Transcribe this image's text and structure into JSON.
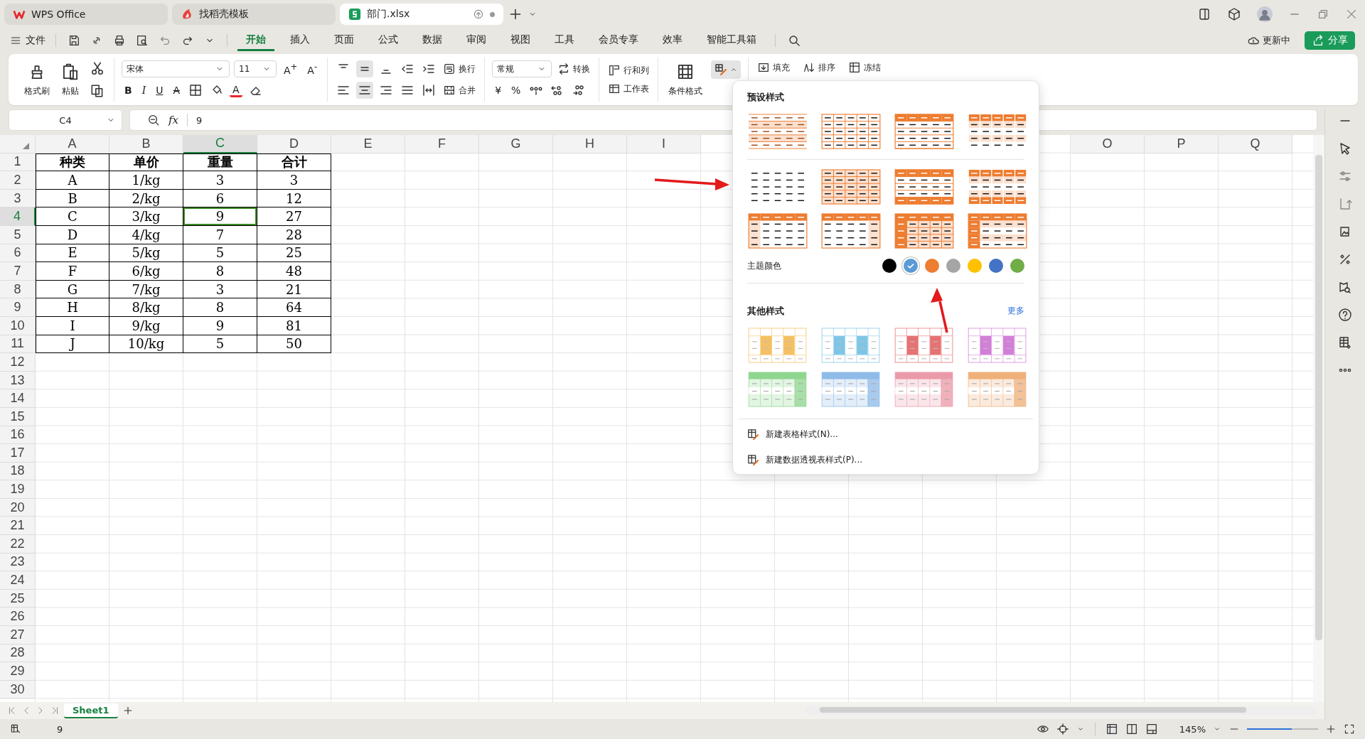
{
  "title_tabs": [
    {
      "label": "WPS Office",
      "kind": "wps",
      "selected": false
    },
    {
      "label": "找稻壳模板",
      "kind": "docer",
      "selected": false
    },
    {
      "label": "部门.xlsx",
      "kind": "sheet",
      "selected": true
    }
  ],
  "menu": {
    "file": "文件",
    "tabs": [
      {
        "label": "开始",
        "selected": true
      },
      {
        "label": "插入",
        "selected": false
      },
      {
        "label": "页面",
        "selected": false
      },
      {
        "label": "公式",
        "selected": false
      },
      {
        "label": "数据",
        "selected": false
      },
      {
        "label": "审阅",
        "selected": false
      },
      {
        "label": "视图",
        "selected": false
      },
      {
        "label": "工具",
        "selected": false
      },
      {
        "label": "会员专享",
        "selected": false
      },
      {
        "label": "效率",
        "selected": false
      },
      {
        "label": "智能工具箱",
        "selected": false
      }
    ],
    "sync": "更新中",
    "share": "分享"
  },
  "ribbon": {
    "format_painter": "格式刷",
    "paste": "粘贴",
    "font_name": "宋体",
    "font_size": "11",
    "grow": "A$^{+}$",
    "shrink": "A$^{-}$",
    "styles": [
      {
        "label": "B",
        "kind": "bold"
      },
      {
        "label": "I",
        "kind": "italic"
      },
      {
        "label": "U",
        "kind": "underline"
      },
      {
        "label": "A",
        "kind": "strike"
      }
    ],
    "font_color": "A",
    "align_top": [
      {
        "kind": "top",
        "selected": false
      },
      {
        "kind": "middle",
        "selected": true
      },
      {
        "kind": "bottom",
        "selected": false
      },
      {
        "kind": "outdent",
        "selected": false
      },
      {
        "kind": "indent",
        "selected": false
      }
    ],
    "wrap": "换行",
    "align_bottom": [
      {
        "kind": "left",
        "selected": false
      },
      {
        "kind": "center",
        "selected": true
      },
      {
        "kind": "right",
        "selected": false
      },
      {
        "kind": "justify",
        "selected": false
      },
      {
        "kind": "distribute",
        "selected": false
      }
    ],
    "merge": "合并",
    "number_format": "常规",
    "convert": "转换",
    "currency": "¥",
    "percent": "%",
    "rows_cols": "行和列",
    "worksheet": "工作表",
    "conditional": "条件格式",
    "table_style": {
      "expanded": true
    },
    "fill": "填充",
    "sort": "排序",
    "freeze": "冻结"
  },
  "formula_bar": {
    "name_box": "C4",
    "fx": "fx",
    "value": "9"
  },
  "sheet": {
    "columns": [
      {
        "label": "A",
        "selected": false
      },
      {
        "label": "B",
        "selected": false
      },
      {
        "label": "C",
        "selected": true
      },
      {
        "label": "D",
        "selected": false
      },
      {
        "label": "E",
        "selected": false
      },
      {
        "label": "F",
        "selected": false
      },
      {
        "label": "G",
        "selected": false
      },
      {
        "label": "H",
        "selected": false
      },
      {
        "label": "I",
        "selected": false
      },
      {},
      {},
      {},
      {},
      {},
      {
        "label": "O",
        "selected": false
      },
      {
        "label": "P",
        "selected": false
      },
      {
        "label": "Q",
        "selected": false
      }
    ],
    "rows": [
      {
        "label": "1",
        "selected": false,
        "kind": "header",
        "cells": [
          {
            "text": "种类",
            "selected": false
          },
          {
            "text": "单价",
            "selected": false
          },
          {
            "text": "重量",
            "selected": false
          },
          {
            "text": "合计",
            "selected": false
          }
        ]
      },
      {
        "label": "2",
        "selected": false,
        "kind": "data",
        "cells": [
          {
            "text": "A",
            "selected": false
          },
          {
            "text": "1/kg",
            "selected": false
          },
          {
            "text": "3",
            "selected": false
          },
          {
            "text": "3",
            "selected": false
          }
        ]
      },
      {
        "label": "3",
        "selected": false,
        "kind": "data",
        "cells": [
          {
            "text": "B",
            "selected": false
          },
          {
            "text": "2/kg",
            "selected": false
          },
          {
            "text": "6",
            "selected": false
          },
          {
            "text": "12",
            "selected": false
          }
        ]
      },
      {
        "label": "4",
        "selected": true,
        "kind": "data",
        "cells": [
          {
            "text": "C",
            "selected": false
          },
          {
            "text": "3/kg",
            "selected": false
          },
          {
            "text": "9",
            "selected": true
          },
          {
            "text": "27",
            "selected": false
          }
        ]
      },
      {
        "label": "5",
        "selected": false,
        "kind": "data",
        "cells": [
          {
            "text": "D",
            "selected": false
          },
          {
            "text": "4/kg",
            "selected": false
          },
          {
            "text": "7",
            "selected": false
          },
          {
            "text": "28",
            "selected": false
          }
        ]
      },
      {
        "label": "6",
        "selected": false,
        "kind": "data",
        "cells": [
          {
            "text": "E",
            "selected": false
          },
          {
            "text": "5/kg",
            "selected": false
          },
          {
            "text": "5",
            "selected": false
          },
          {
            "text": "25",
            "selected": false
          }
        ]
      },
      {
        "label": "7",
        "selected": false,
        "kind": "data",
        "cells": [
          {
            "text": "F",
            "selected": false
          },
          {
            "text": "6/kg",
            "selected": false
          },
          {
            "text": "8",
            "selected": false
          },
          {
            "text": "48",
            "selected": false
          }
        ]
      },
      {
        "label": "8",
        "selected": false,
        "kind": "data",
        "cells": [
          {
            "text": "G",
            "selected": false
          },
          {
            "text": "7/kg",
            "selected": false
          },
          {
            "text": "3",
            "selected": false
          },
          {
            "text": "21",
            "selected": false
          }
        ]
      },
      {
        "label": "9",
        "selected": false,
        "kind": "data",
        "cells": [
          {
            "text": "H",
            "selected": false
          },
          {
            "text": "8/kg",
            "selected": false
          },
          {
            "text": "8",
            "selected": false
          },
          {
            "text": "64",
            "selected": false
          }
        ]
      },
      {
        "label": "10",
        "selected": false,
        "kind": "data",
        "cells": [
          {
            "text": "I",
            "selected": false
          },
          {
            "text": "9/kg",
            "selected": false
          },
          {
            "text": "9",
            "selected": false
          },
          {
            "text": "81",
            "selected": false
          }
        ]
      },
      {
        "label": "11",
        "selected": false,
        "kind": "data",
        "cells": [
          {
            "text": "J",
            "selected": false
          },
          {
            "text": "10/kg",
            "selected": false
          },
          {
            "text": "5",
            "selected": false
          },
          {
            "text": "50",
            "selected": false
          }
        ]
      },
      {
        "label": "12",
        "selected": false
      },
      {
        "label": "13",
        "selected": false
      },
      {
        "label": "14",
        "selected": false
      },
      {
        "label": "15",
        "selected": false
      },
      {
        "label": "16",
        "selected": false
      },
      {
        "label": "17",
        "selected": false
      },
      {
        "label": "18",
        "selected": false
      },
      {
        "label": "19",
        "selected": false
      },
      {
        "label": "20",
        "selected": false
      },
      {
        "label": "21",
        "selected": false
      },
      {
        "label": "22",
        "selected": false
      },
      {
        "label": "23",
        "selected": false
      },
      {
        "label": "24",
        "selected": false
      },
      {
        "label": "25",
        "selected": false
      },
      {
        "label": "26",
        "selected": false
      },
      {
        "label": "27",
        "selected": false
      },
      {
        "label": "28",
        "selected": false
      },
      {
        "label": "29",
        "selected": false
      },
      {
        "label": "30",
        "selected": false
      }
    ]
  },
  "style_panel": {
    "preset_title": "预设样式",
    "preset_groups": [
      {
        "styles": [
          {
            "kind": "banded-lines"
          },
          {
            "kind": "grid"
          },
          {
            "kind": "header-rows"
          },
          {
            "kind": "header-banded"
          }
        ]
      },
      {
        "styles": [
          {
            "kind": "plain"
          },
          {
            "kind": "filled-grid"
          },
          {
            "kind": "header-total"
          },
          {
            "kind": "header-banded-total"
          },
          {
            "kind": "header-first-col"
          },
          {
            "kind": "header-last-col"
          },
          {
            "kind": "header-dark-first-col"
          },
          {
            "kind": "header-dark-first-col-bands"
          }
        ]
      }
    ],
    "theme_label": "主题颜色",
    "theme_colors": [
      {
        "color": "#000000",
        "selected": false
      },
      {
        "color": "#5b9bd5",
        "selected": true
      },
      {
        "color": "#ed7d31",
        "selected": false
      },
      {
        "color": "#a5a5a5",
        "selected": false
      },
      {
        "color": "#ffc000",
        "selected": false
      },
      {
        "color": "#4472c4",
        "selected": false
      },
      {
        "color": "#70ad47",
        "selected": false
      }
    ],
    "other_title": "其他样式",
    "more": "更多",
    "other_styles": [
      {
        "kind": "column-bands",
        "color": "#f5c063"
      },
      {
        "kind": "column-bands",
        "color": "#7fc6e6"
      },
      {
        "kind": "column-bands",
        "color": "#e57373"
      },
      {
        "kind": "column-bands",
        "color": "#d27fd8"
      },
      {
        "kind": "header-last-col",
        "color": "#8fd68f"
      },
      {
        "kind": "header-last-col",
        "color": "#8fbbe8"
      },
      {
        "kind": "header-last-col",
        "color": "#eb9aaa"
      },
      {
        "kind": "header-last-col",
        "color": "#f0b07a"
      }
    ],
    "actions": [
      "新建表格样式(N)...",
      "新建数据透视表样式(P)..."
    ]
  },
  "sheet_tabs": [
    {
      "label": "Sheet1",
      "selected": true
    }
  ],
  "status": {
    "value": "9",
    "zoom": "145%",
    "zoom_slider": {
      "level": 0.63
    }
  }
}
